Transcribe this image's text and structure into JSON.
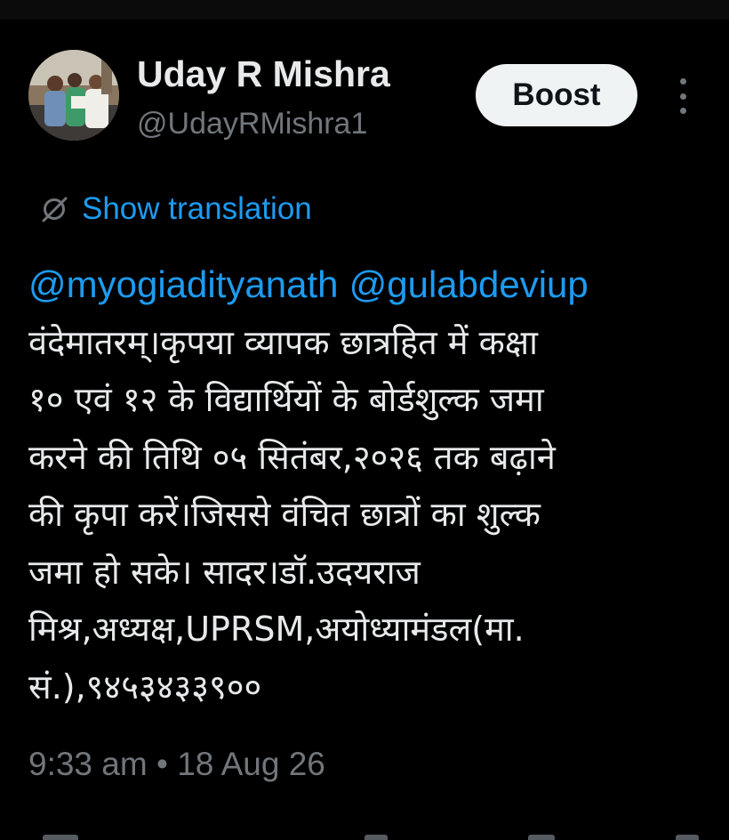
{
  "post": {
    "author": {
      "name": "Uday R Mishra",
      "handle": "@UdayRMishra1",
      "avatar_icon": "user-avatar-photo"
    },
    "boost_label": "Boost",
    "more_icon": "more-vertical-icon",
    "translation": {
      "icon": "translate-icon",
      "label": "Show translation"
    },
    "mentions": [
      "@myogiadityanath",
      "@gulabdeviup"
    ],
    "body_lines": [
      "वंदेमातरम्।कृपया व्यापक छात्रहित में कक्षा",
      "१० एवं १२ के विद्यार्थियों के बोर्डशुल्क जमा",
      "करने की तिथि ०५ सितंबर,२०२६ तक बढ़ाने",
      "की कृपा करें।जिससे वंचित छात्रों का शुल्क",
      "जमा हो सके। सादर।डॉ.उदयराज",
      "मिश्र,अध्यक्ष,UPRSM,अयोध्यामंडल(मा.",
      "सं.),९४५३४३३९००"
    ],
    "timestamp": "9:33 am • 18 Aug 26"
  },
  "colors": {
    "background": "#000000",
    "text": "#e7e9ea",
    "secondary": "#71767b",
    "link": "#1d9bf0",
    "button_bg": "#eff3f4",
    "button_text": "#0f1419"
  }
}
